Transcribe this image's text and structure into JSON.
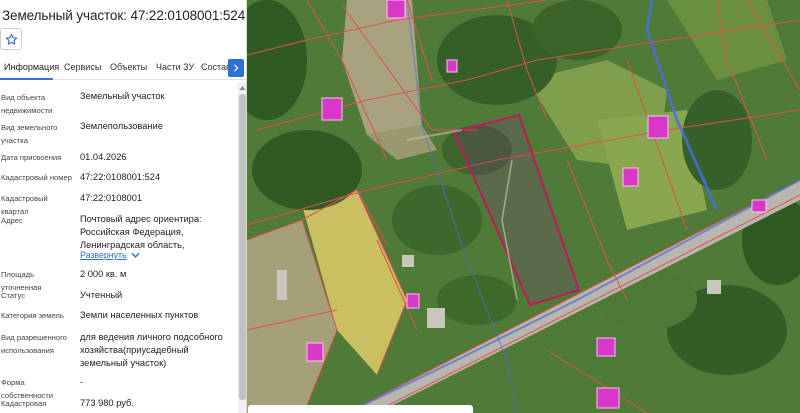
{
  "header": {
    "title": "Земельный участок: 47:22:0108001:524"
  },
  "tabs": [
    "Информация",
    "Сервисы",
    "Объекты",
    "Части ЗУ",
    "Состав"
  ],
  "rows": [
    {
      "label": "Вид объекта недвижимости",
      "value": "Земельный участок"
    },
    {
      "label": "Вид земельного участка",
      "value": "Землепользование"
    },
    {
      "label": "Дата присвоения",
      "value": "01.04.2026"
    },
    {
      "label": "Кадастровый номер",
      "value": "47:22:0108001:524"
    },
    {
      "label": "Кадастровый квартал",
      "value": "47:22:0108001"
    },
    {
      "label": "Адрес",
      "value": "Почтовый адрес ориентира: Российская Федерация, Ленинградская область,"
    },
    {
      "label": "Площадь уточненная",
      "value": "2 000 кв. м"
    },
    {
      "label": "Статус",
      "value": "Учтенный"
    },
    {
      "label": "Категория земель",
      "value": "Земли населенных пунктов"
    },
    {
      "label": "Вид разрешенного использования",
      "value": "для ведения личного подсобного хозяйства(приусадебный земельный участок)"
    },
    {
      "label": "Форма собственности",
      "value": "-"
    },
    {
      "label": "Кадастровая",
      "value": "773 980 руб."
    }
  ],
  "expand_label": "Развернуть",
  "icons": {
    "favorite": "star-icon",
    "tabs_next": "chevron-right-icon",
    "expand": "chevron-down-icon"
  },
  "colors": {
    "accent": "#2f6fd6",
    "parcel_outline": "#c2185b",
    "parcel_fill": "#e040fb",
    "border_lines": "#e05050",
    "road_lines": "#4a6ee0"
  }
}
